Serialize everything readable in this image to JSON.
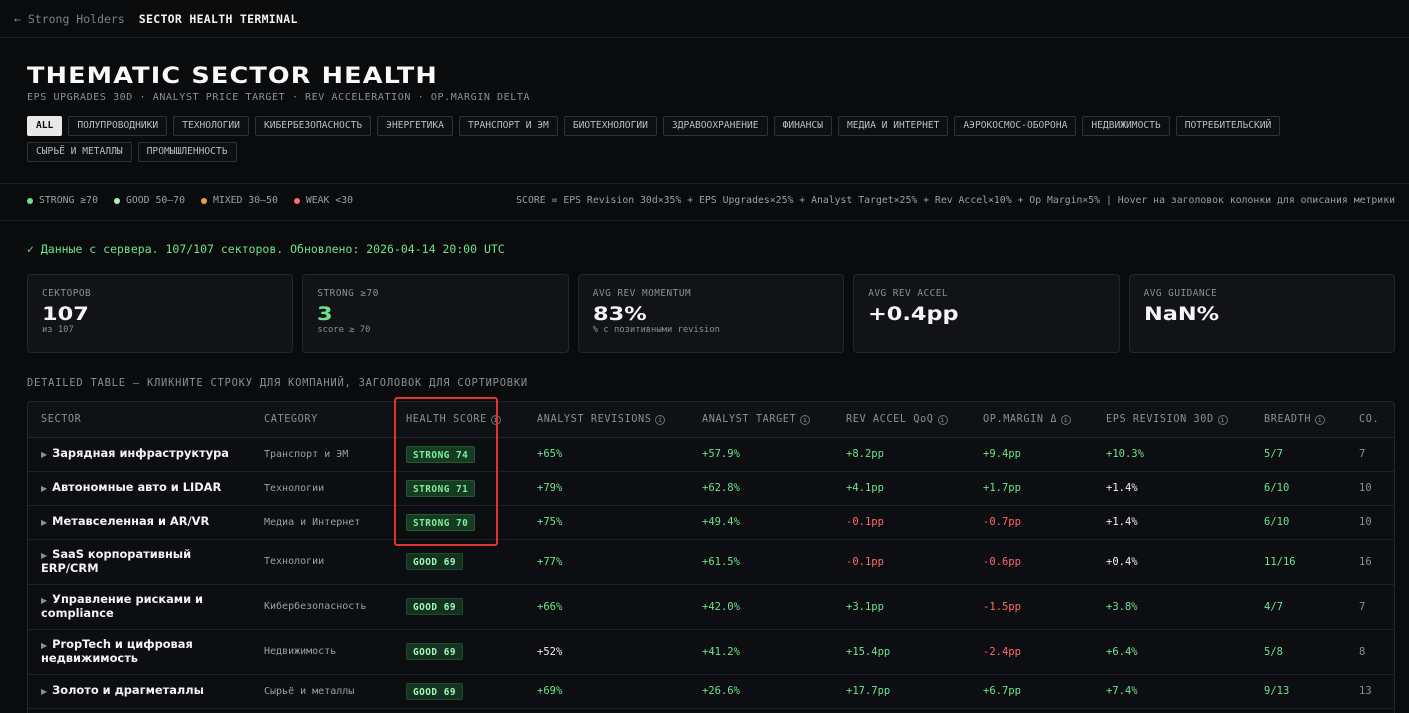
{
  "topbar": {
    "back_label": "← Strong Holders",
    "title": "SECTOR HEALTH TERMINAL"
  },
  "hero": {
    "title": "THEMATIC SECTOR HEALTH",
    "subtitle": "EPS UPGRADES 30D · ANALYST PRICE TARGET · REV ACCELERATION · OP.MARGIN DELTA"
  },
  "filters": [
    {
      "label": "ALL",
      "active": true
    },
    {
      "label": "ПОЛУПРОВОДНИКИ"
    },
    {
      "label": "ТЕХНОЛОГИИ"
    },
    {
      "label": "КИБЕРБЕЗОПАСНОСТЬ"
    },
    {
      "label": "ЭНЕРГЕТИКА"
    },
    {
      "label": "ТРАНСПОРТ И ЭМ"
    },
    {
      "label": "БИОТЕХНОЛОГИИ"
    },
    {
      "label": "ЗДРАВООХРАНЕНИЕ"
    },
    {
      "label": "ФИНАНСЫ"
    },
    {
      "label": "МЕДИА И ИНТЕРНЕТ"
    },
    {
      "label": "АЭРОКОСМОС-ОБОРОНА"
    },
    {
      "label": "НЕДВИЖИМОСТЬ"
    },
    {
      "label": "ПОТРЕБИТЕЛЬСКИЙ"
    },
    {
      "label": "СЫРЬЁ И МЕТАЛЛЫ"
    },
    {
      "label": "ПРОМЫШЛЕННОСТЬ"
    }
  ],
  "legend": [
    {
      "label": "STRONG ≥70",
      "color": "#6fe38a"
    },
    {
      "label": "GOOD 50–70",
      "color": "#a6f5bb"
    },
    {
      "label": "MIXED 30–50",
      "color": "#f0a33a"
    },
    {
      "label": "WEAK <30",
      "color": "#ff6b6b"
    }
  ],
  "formula": "SCORE = EPS Revision 30d×35% + EPS Upgrades×25% + Analyst Target×25% + Rev Accel×10% + Op Margin×5%  |  Hover на заголовок колонки для описания метрики",
  "status": "✓ Данные с сервера. 107/107 секторов. Обновлено: 2026-04-14 20:00 UTC",
  "cards": [
    {
      "label": "СЕКТОРОВ",
      "value": "107",
      "note": "из 107",
      "green": false
    },
    {
      "label": "STRONG ≥70",
      "value": "3",
      "note": "score ≥ 70",
      "green": true
    },
    {
      "label": "AVG REV MOMENTUM",
      "value": "83%",
      "note": "% с позитивными revision",
      "green": false
    },
    {
      "label": "AVG REV ACCEL",
      "value": "+0.4pp",
      "note": "",
      "green": false
    },
    {
      "label": "AVG GUIDANCE",
      "value": "NaN%",
      "note": "",
      "green": false
    }
  ],
  "table_caption": "DETAILED TABLE — КЛИКНИТЕ СТРОКУ ДЛЯ КОМПАНИЙ, ЗАГОЛОВОК ДЛЯ СОРТИРОВКИ",
  "columns": [
    {
      "label": "SECTOR",
      "info": false
    },
    {
      "label": "CATEGORY",
      "info": false
    },
    {
      "label": "HEALTH SCORE",
      "info": true
    },
    {
      "label": "ANALYST REVISIONS",
      "info": true
    },
    {
      "label": "ANALYST TARGET",
      "info": true
    },
    {
      "label": "REV ACCEL QoQ",
      "info": true
    },
    {
      "label": "OP.MARGIN Δ",
      "info": true
    },
    {
      "label": "EPS REVISION 30D",
      "info": true
    },
    {
      "label": "BREADTH",
      "info": true
    },
    {
      "label": "CO.",
      "info": false
    }
  ],
  "rows": [
    {
      "sector": "Зарядная инфраструктура",
      "category": "Транспорт и ЭМ",
      "badge": "STRONG 74",
      "tier": "strong",
      "revisions": "+65%",
      "revisions_tone": "pos",
      "target": "+57.9%",
      "target_tone": "pos",
      "accel": "+8.2pp",
      "accel_tone": "pos",
      "margin": "+9.4pp",
      "margin_tone": "pos",
      "eps": "+10.3%",
      "eps_tone": "pos",
      "breadth": "5/7",
      "co": "7"
    },
    {
      "sector": "Автономные авто и LIDAR",
      "category": "Технологии",
      "badge": "STRONG 71",
      "tier": "strong",
      "revisions": "+79%",
      "revisions_tone": "pos",
      "target": "+62.8%",
      "target_tone": "pos",
      "accel": "+4.1pp",
      "accel_tone": "pos",
      "margin": "+1.7pp",
      "margin_tone": "pos",
      "eps": "+1.4%",
      "eps_tone": "neu",
      "breadth": "6/10",
      "co": "10"
    },
    {
      "sector": "Метавселенная и AR/VR",
      "category": "Медиа и Интернет",
      "badge": "STRONG 70",
      "tier": "strong",
      "revisions": "+75%",
      "revisions_tone": "pos",
      "target": "+49.4%",
      "target_tone": "pos",
      "accel": "-0.1pp",
      "accel_tone": "neg",
      "margin": "-0.7pp",
      "margin_tone": "neg",
      "eps": "+1.4%",
      "eps_tone": "neu",
      "breadth": "6/10",
      "co": "10"
    },
    {
      "sector": "SaaS корпоративный ERP/CRM",
      "category": "Технологии",
      "badge": "GOOD 69",
      "tier": "good",
      "revisions": "+77%",
      "revisions_tone": "pos",
      "target": "+61.5%",
      "target_tone": "pos",
      "accel": "-0.1pp",
      "accel_tone": "neg",
      "margin": "-0.6pp",
      "margin_tone": "neg",
      "eps": "+0.4%",
      "eps_tone": "neu",
      "breadth": "11/16",
      "co": "16"
    },
    {
      "sector": "Управление рисками и compliance",
      "category": "Кибербезопасность",
      "badge": "GOOD 69",
      "tier": "good",
      "revisions": "+66%",
      "revisions_tone": "pos",
      "target": "+42.0%",
      "target_tone": "pos",
      "accel": "+3.1pp",
      "accel_tone": "pos",
      "margin": "-1.5pp",
      "margin_tone": "neg",
      "eps": "+3.8%",
      "eps_tone": "pos",
      "breadth": "4/7",
      "co": "7"
    },
    {
      "sector": "PropTech и цифровая недвижимость",
      "category": "Недвижимость",
      "badge": "GOOD 69",
      "tier": "good",
      "revisions": "+52%",
      "revisions_tone": "neu",
      "target": "+41.2%",
      "target_tone": "pos",
      "accel": "+15.4pp",
      "accel_tone": "pos",
      "margin": "-2.4pp",
      "margin_tone": "neg",
      "eps": "+6.4%",
      "eps_tone": "pos",
      "breadth": "5/8",
      "co": "8"
    },
    {
      "sector": "Золото и драгметаллы",
      "category": "Сырьё и металлы",
      "badge": "GOOD 69",
      "tier": "good",
      "revisions": "+69%",
      "revisions_tone": "pos",
      "target": "+26.6%",
      "target_tone": "pos",
      "accel": "+17.7pp",
      "accel_tone": "pos",
      "margin": "+6.7pp",
      "margin_tone": "pos",
      "eps": "+7.4%",
      "eps_tone": "pos",
      "breadth": "9/13",
      "co": "13"
    }
  ]
}
